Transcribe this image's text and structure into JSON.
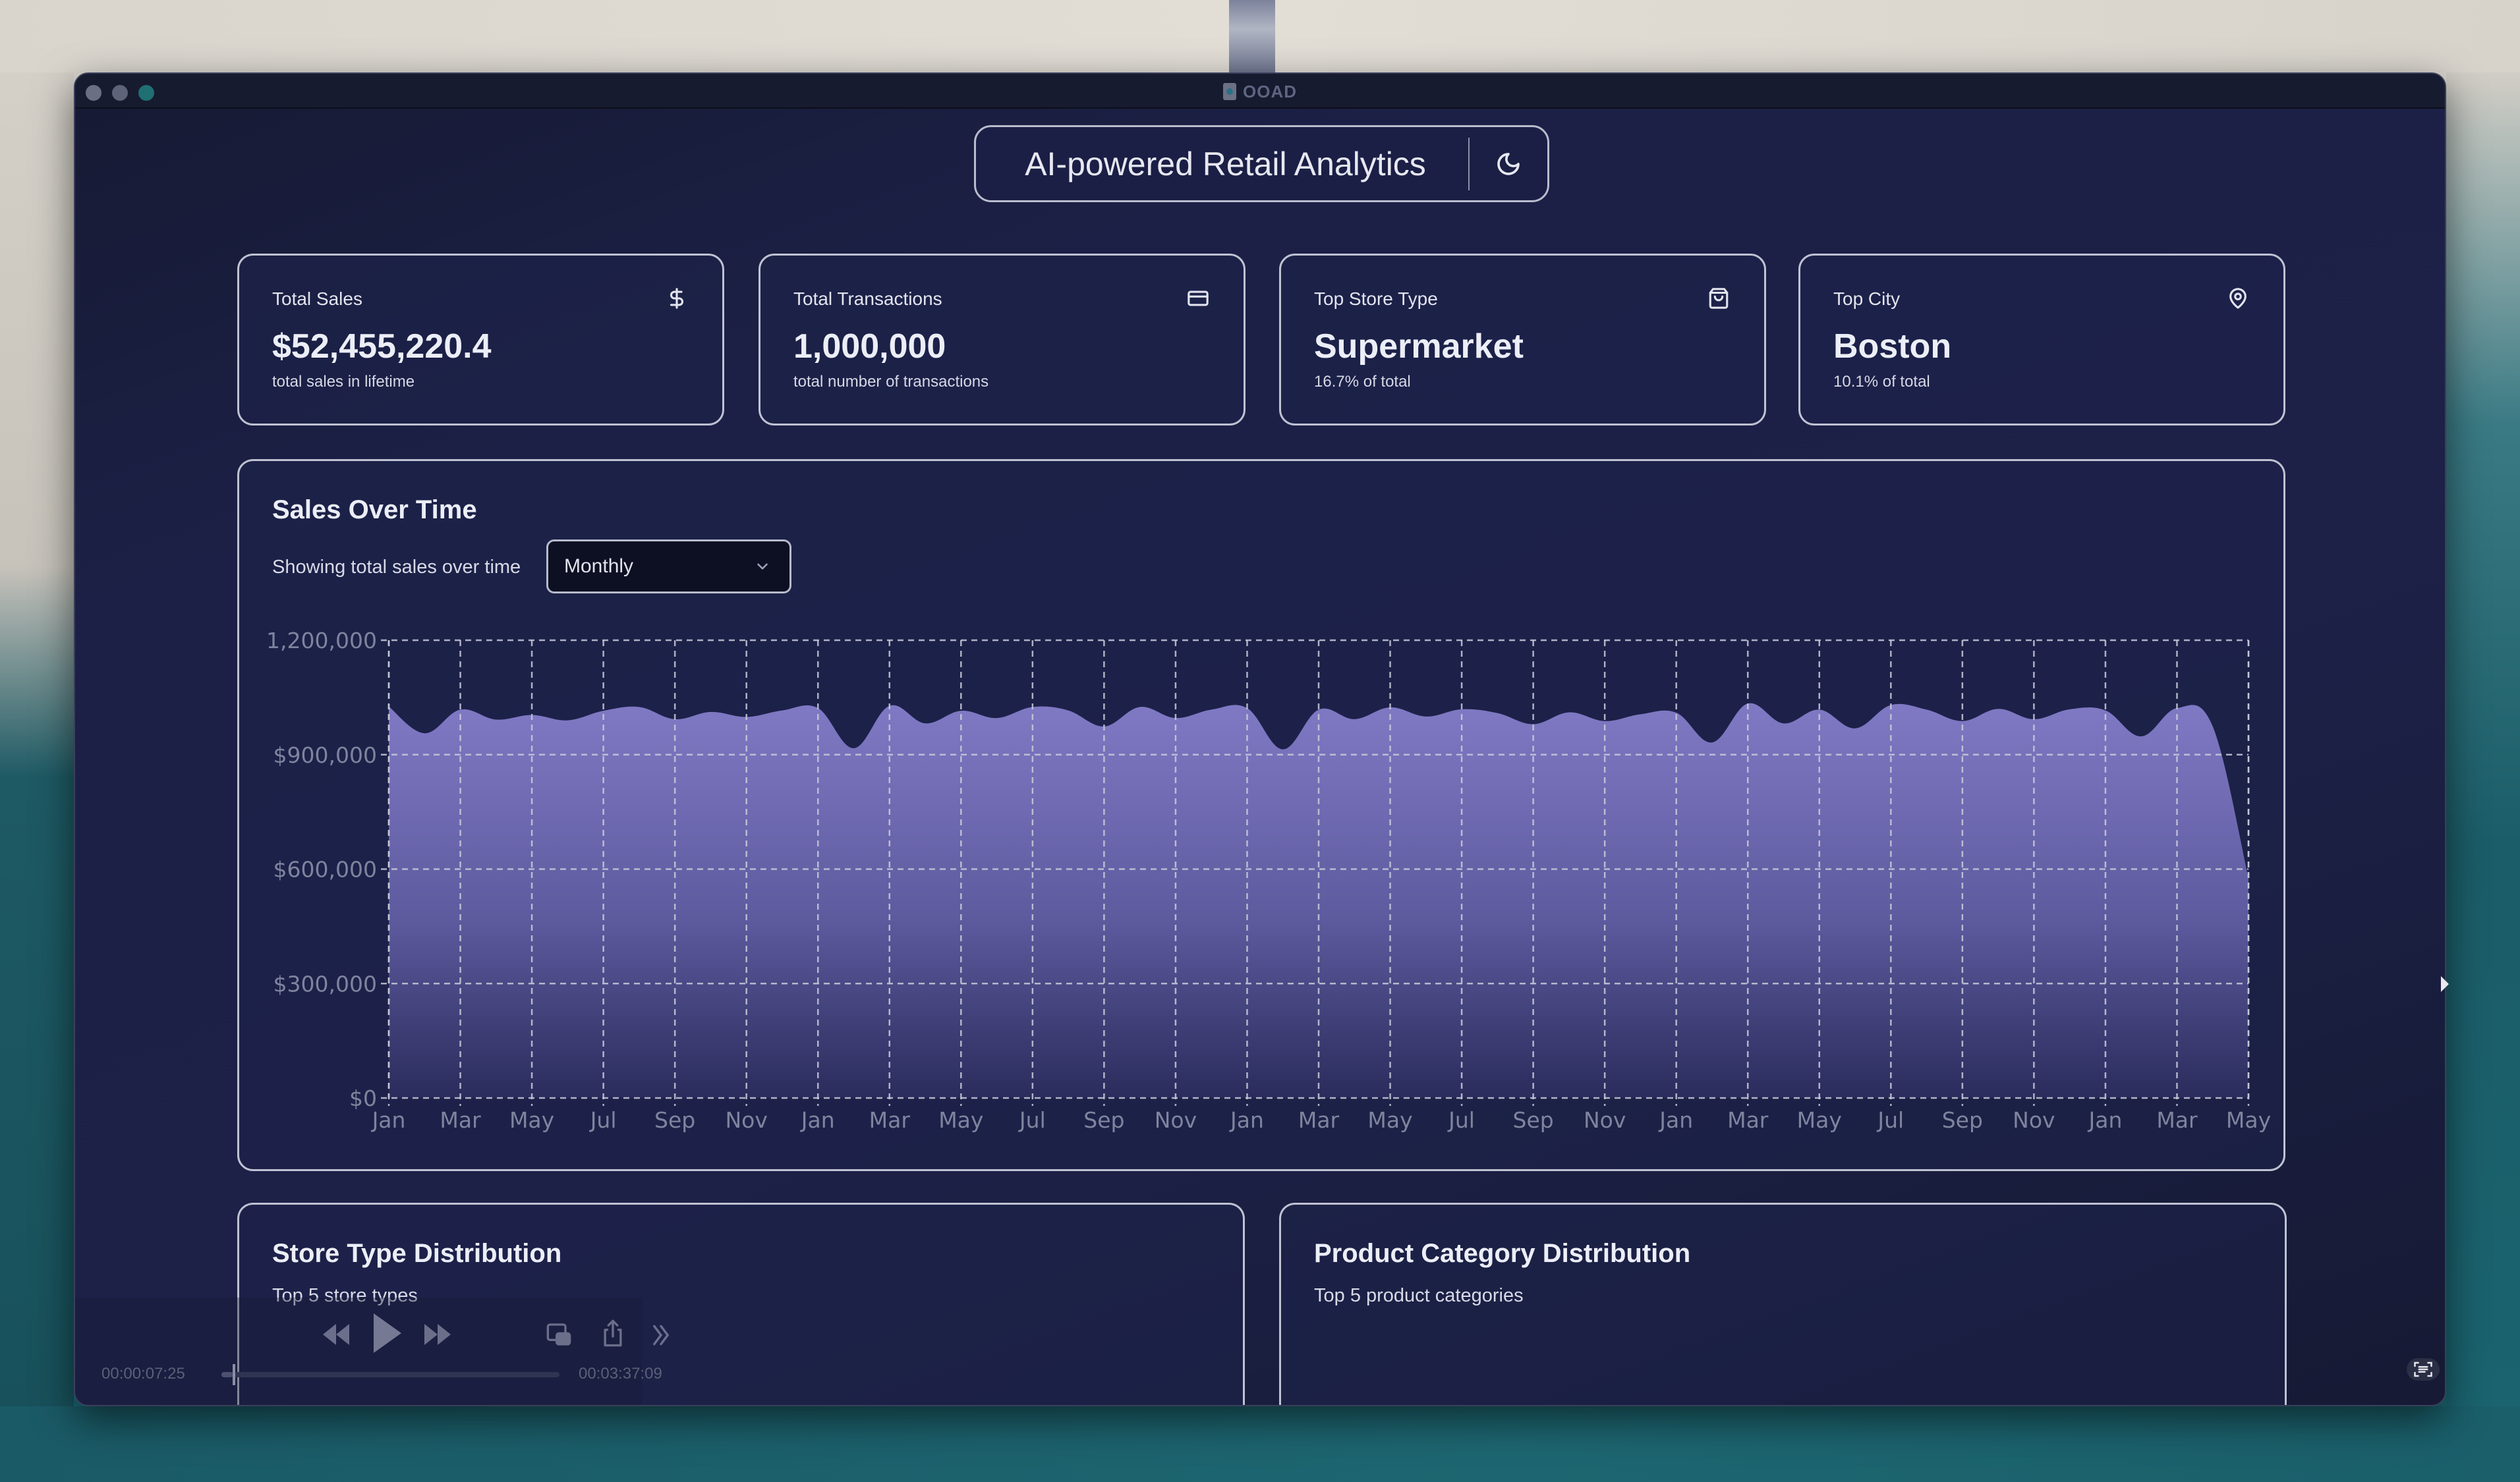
{
  "window": {
    "title": "OOAD"
  },
  "header": {
    "title": "AI-powered Retail Analytics",
    "theme_toggle_icon": "moon-icon"
  },
  "kpis": [
    {
      "label": "Total Sales",
      "value": "$52,455,220.4",
      "sub": "total sales in lifetime",
      "icon": "dollar-icon"
    },
    {
      "label": "Total Transactions",
      "value": "1,000,000",
      "sub": "total number of transactions",
      "icon": "credit-card-icon"
    },
    {
      "label": "Top Store Type",
      "value": "Supermarket",
      "sub": "16.7% of total",
      "icon": "shopping-bag-icon"
    },
    {
      "label": "Top City",
      "value": "Boston",
      "sub": "10.1% of total",
      "icon": "map-pin-icon"
    }
  ],
  "sales_chart": {
    "title": "Sales Over Time",
    "description": "Showing total sales over time",
    "period_select": {
      "value": "Monthly"
    }
  },
  "chart_data": {
    "type": "area",
    "title": "Sales Over Time",
    "xlabel": "",
    "ylabel": "",
    "x_ticks": [
      "Jan",
      "Mar",
      "May",
      "Jul",
      "Sep",
      "Nov",
      "Jan",
      "Mar",
      "May",
      "Jul",
      "Sep",
      "Nov",
      "Jan",
      "Mar",
      "May",
      "Jul",
      "Sep",
      "Nov",
      "Jan",
      "Mar",
      "May",
      "Jul",
      "Sep",
      "Nov",
      "Jan",
      "Mar",
      "May"
    ],
    "y_ticks": [
      "$0",
      "$300,000",
      "$600,000",
      "$900,000",
      "1,200,000"
    ],
    "y_tick_values": [
      0,
      300000,
      600000,
      900000,
      1200000
    ],
    "ylim": [
      0,
      1200000
    ],
    "grid": true,
    "fill_color_top": "#8079c4",
    "fill_color_bottom": "#2a2c5c",
    "series": [
      {
        "name": "Total Sales",
        "values": [
          1026000,
          956000,
          1018000,
          992000,
          1004000,
          990000,
          1015000,
          1025000,
          993000,
          1012000,
          999000,
          1016000,
          1022000,
          917000,
          1028000,
          982000,
          1015000,
          996000,
          1025000,
          1016000,
          974000,
          1025000,
          996000,
          1018000,
          1022000,
          914000,
          1018000,
          993000,
          1024000,
          1000000,
          1019000,
          1009000,
          980000,
          1011000,
          988000,
          1006000,
          1010000,
          932000,
          1034000,
          982000,
          1018000,
          969000,
          1030000,
          1018000,
          988000,
          1020000,
          993000,
          1019000,
          1016000,
          948000,
          1022000,
          974000,
          576000
        ]
      }
    ]
  },
  "distributions": [
    {
      "title": "Store Type Distribution",
      "subtitle": "Top 5 store types"
    },
    {
      "title": "Product Category Distribution",
      "subtitle": "Top 5 product categories"
    }
  ],
  "media_player": {
    "elapsed": "00:00:07:25",
    "duration": "00:03:37:09",
    "progress": 0.034
  }
}
